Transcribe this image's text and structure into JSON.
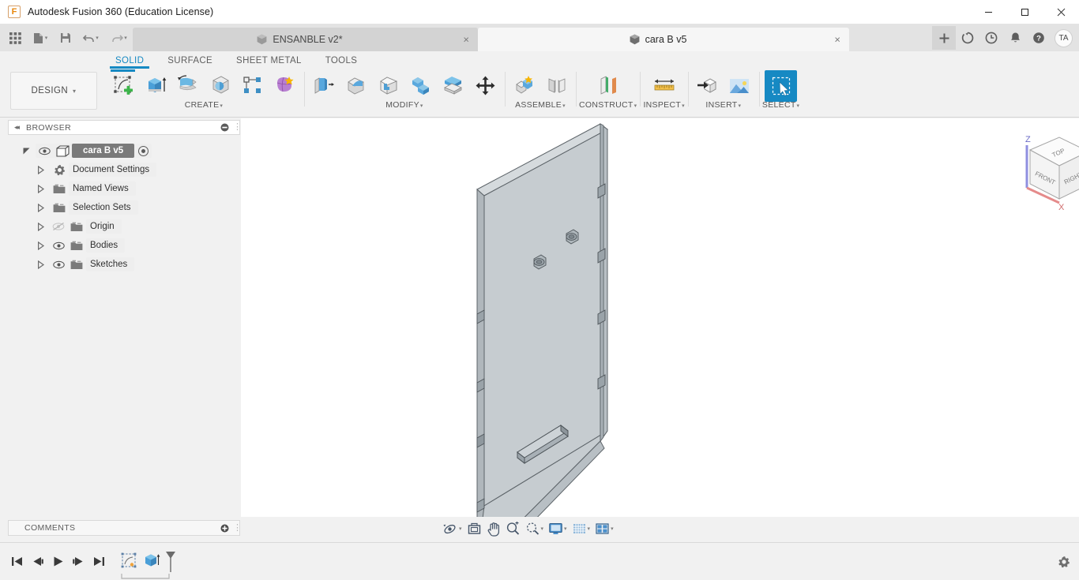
{
  "window": {
    "title": "Autodesk Fusion 360 (Education License)",
    "logo_letter": "F",
    "minimize": "—",
    "maximize": "☐",
    "close": "✕"
  },
  "quick_access": {
    "grid_icon": "apps-grid-icon",
    "new_label": "new-document-icon",
    "save_label": "save-icon",
    "undo_label": "undo-icon",
    "redo_label": "redo-icon"
  },
  "tabs": [
    {
      "label": "ENSANBLE v2*",
      "active": false,
      "close": "×"
    },
    {
      "label": "cara B v5",
      "active": true,
      "close": "×"
    }
  ],
  "tab_actions": {
    "new_tab": "+",
    "sync_icon": "sync-icon",
    "history_icon": "clock-icon",
    "notifications_icon": "bell-icon",
    "help_icon": "help-icon",
    "avatar_initials": "TA"
  },
  "ribbon_tabs": [
    {
      "label": "SOLID",
      "selected": true
    },
    {
      "label": "SURFACE",
      "selected": false
    },
    {
      "label": "SHEET METAL",
      "selected": false
    },
    {
      "label": "TOOLS",
      "selected": false
    }
  ],
  "workspace": {
    "label": "DESIGN",
    "caret": "▾"
  },
  "ribbon_groups": [
    {
      "name": "CREATE",
      "label": "CREATE",
      "caret": "▾",
      "icons": [
        "create-sketch-icon",
        "extrude-icon",
        "revolve-icon",
        "sweep-icon",
        "pattern-icon",
        "form-icon"
      ]
    },
    {
      "name": "MODIFY",
      "label": "MODIFY",
      "caret": "▾",
      "icons": [
        "press-pull-icon",
        "fillet-icon",
        "shell-icon",
        "combine-icon",
        "offset-face-icon",
        "move-copy-icon"
      ]
    },
    {
      "name": "ASSEMBLE",
      "label": "ASSEMBLE",
      "caret": "▾",
      "icons": [
        "new-component-icon",
        "joint-icon"
      ]
    },
    {
      "name": "CONSTRUCT",
      "label": "CONSTRUCT",
      "caret": "▾",
      "icons": [
        "offset-plane-icon"
      ]
    },
    {
      "name": "INSPECT",
      "label": "INSPECT",
      "caret": "▾",
      "icons": [
        "measure-icon"
      ]
    },
    {
      "name": "INSERT",
      "label": "INSERT",
      "caret": "▾",
      "icons": [
        "insert-derive-icon",
        "insert-image-icon"
      ]
    },
    {
      "name": "SELECT",
      "label": "SELECT",
      "caret": "▾",
      "icons": [
        "select-window-icon"
      ]
    }
  ],
  "browser": {
    "title": "BROWSER",
    "collapse_icon": "collapse-left-icon",
    "minus_icon": "minus-circle-icon",
    "tree": [
      {
        "label": "cara B v5",
        "icon": "component-icon",
        "eye": "visible",
        "arrow": "expanded",
        "root": true,
        "radio": true
      },
      {
        "label": "Document Settings",
        "icon": "gear-icon",
        "eye": "none",
        "arrow": "collapsed",
        "root": false
      },
      {
        "label": "Named Views",
        "icon": "folder-icon",
        "eye": "none",
        "arrow": "collapsed",
        "root": false
      },
      {
        "label": "Selection Sets",
        "icon": "folder-icon",
        "eye": "none",
        "arrow": "collapsed",
        "root": false
      },
      {
        "label": "Origin",
        "icon": "folder-icon",
        "eye": "hidden",
        "arrow": "collapsed",
        "root": false
      },
      {
        "label": "Bodies",
        "icon": "folder-icon",
        "eye": "visible",
        "arrow": "collapsed",
        "root": false
      },
      {
        "label": "Sketches",
        "icon": "folder-icon",
        "eye": "visible",
        "arrow": "collapsed",
        "root": false
      }
    ]
  },
  "viewcube": {
    "top_face": "TOP",
    "front_face": "FRONT",
    "right_face": "RIGHT",
    "axis_z": "Z",
    "axis_x": "X",
    "z_color": "#8f8fe0",
    "x_color": "#e58b8b"
  },
  "model": {
    "name": "panel-body",
    "face_color": "#c6ccd0",
    "edge_color": "#5a6166",
    "side_color": "#b4bbc0",
    "dark_color": "#97a0a6"
  },
  "view_toolbar": [
    {
      "name": "orbit",
      "icon": "orbit-icon",
      "caret": "▾"
    },
    {
      "name": "look-at",
      "icon": "look-at-icon",
      "caret": ""
    },
    {
      "name": "pan",
      "icon": "pan-hand-icon",
      "caret": ""
    },
    {
      "name": "zoom",
      "icon": "zoom-icon",
      "caret": ""
    },
    {
      "name": "zoom-window",
      "icon": "zoom-window-icon",
      "caret": "▾"
    },
    {
      "name": "display-settings",
      "icon": "display-monitor-icon",
      "caret": "▾"
    },
    {
      "name": "grid-snaps",
      "icon": "grid-icon",
      "caret": "▾"
    },
    {
      "name": "viewports",
      "icon": "viewports-icon",
      "caret": "▾"
    }
  ],
  "comments": {
    "title": "COMMENTS",
    "add_icon": "plus-circle-icon"
  },
  "timeline": {
    "controls": [
      {
        "name": "go-to-beginning",
        "icon": "skip-start-icon"
      },
      {
        "name": "step-back",
        "icon": "step-back-icon"
      },
      {
        "name": "play",
        "icon": "play-icon"
      },
      {
        "name": "step-forward",
        "icon": "step-forward-icon"
      },
      {
        "name": "go-to-end",
        "icon": "skip-end-icon"
      }
    ],
    "features": [
      {
        "name": "sketch-feature",
        "icon": "sketch-icon"
      },
      {
        "name": "extrude-feature",
        "icon": "extrude-icon"
      }
    ],
    "marker": "end-marker",
    "settings_icon": "gear-icon"
  }
}
